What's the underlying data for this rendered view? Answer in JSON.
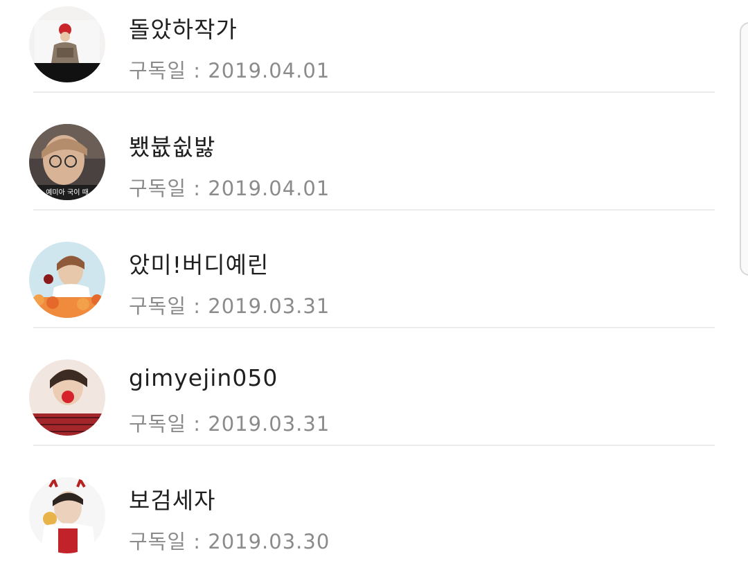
{
  "subscribers": [
    {
      "name": "돌았하작가",
      "date_label": "구독일 : 2019.04.01",
      "avatar_icon": "profile-photo"
    },
    {
      "name": "뵀븂쉾밣",
      "date_label": "구독일 : 2019.04.01",
      "avatar_icon": "profile-photo",
      "avatar_caption": "예미아 국이 때"
    },
    {
      "name": "았미!버디예린",
      "date_label": "구독일 : 2019.03.31",
      "avatar_icon": "profile-photo"
    },
    {
      "name": "gimyejin050",
      "date_label": "구독일 : 2019.03.31",
      "avatar_icon": "profile-photo"
    },
    {
      "name": "보검세자",
      "date_label": "구독일 : 2019.03.30",
      "avatar_icon": "profile-photo"
    }
  ],
  "colors": {
    "name_text": "#1f1f1f",
    "date_text": "#8b8b8b",
    "divider": "#ececec"
  }
}
